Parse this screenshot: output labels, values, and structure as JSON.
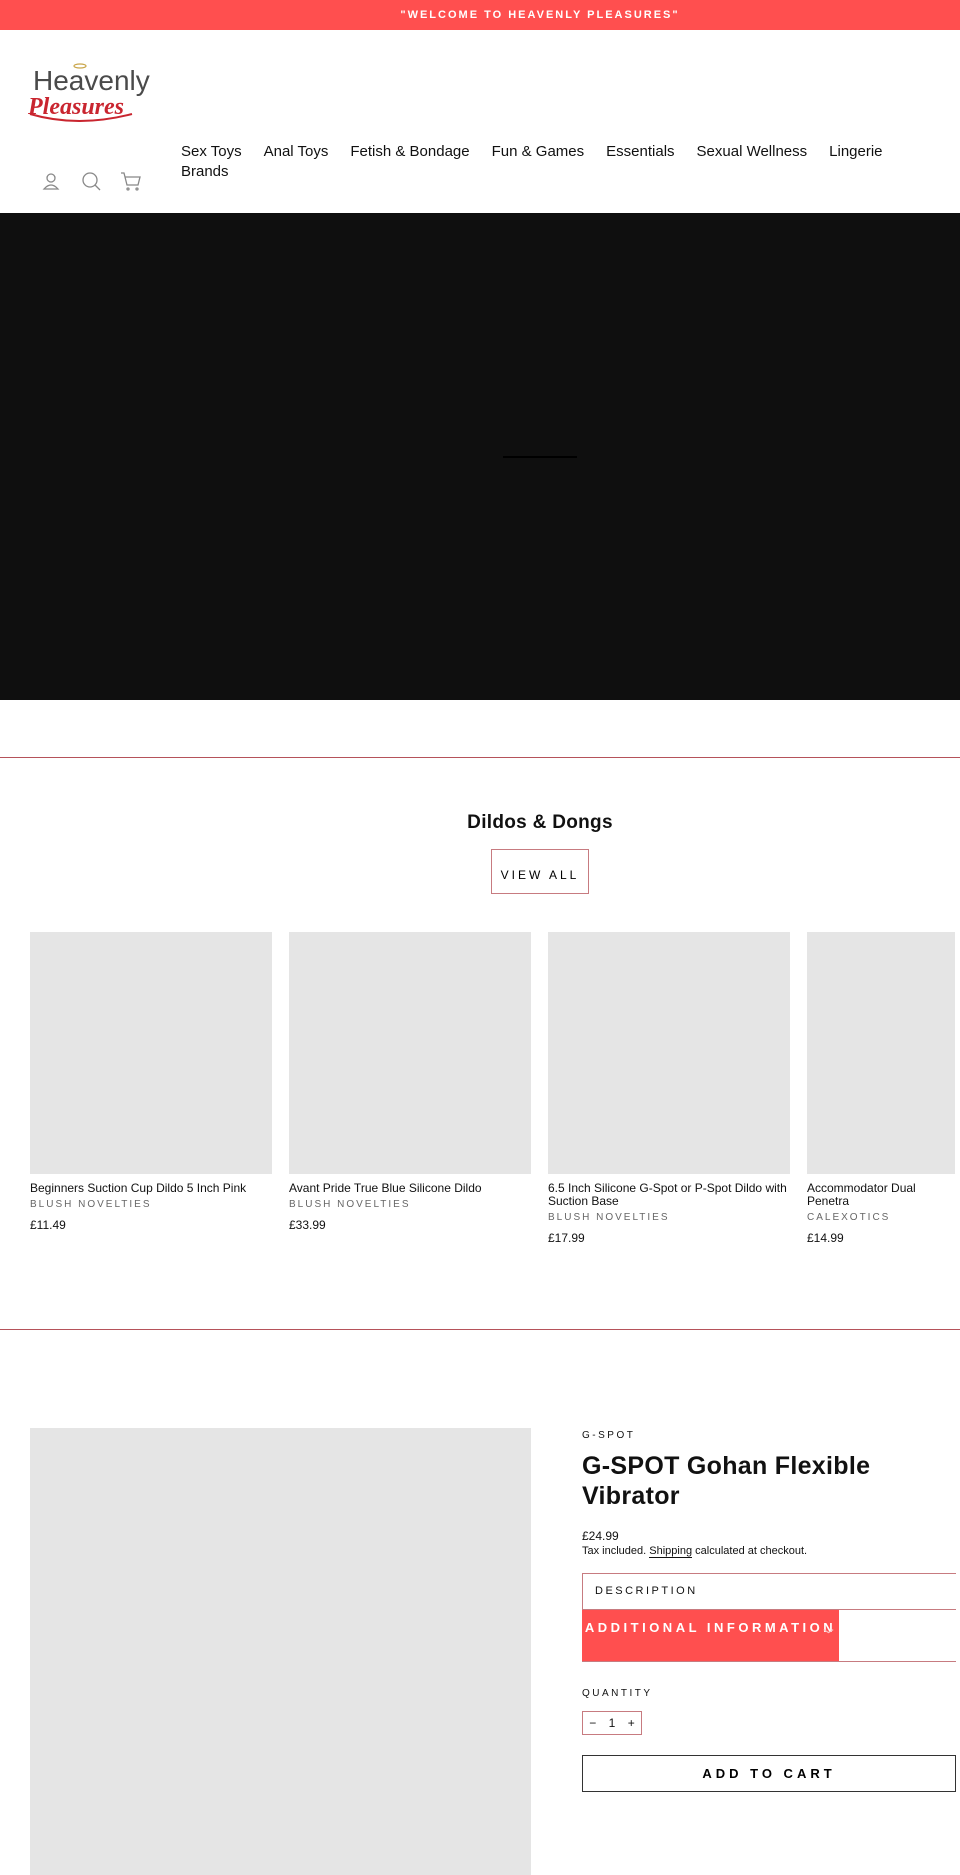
{
  "announcement": "\"WELCOME TO HEAVENLY PLEASURES\"",
  "logo": {
    "line1": "Heavenly",
    "line2": "Pleasures"
  },
  "nav": [
    "Sex Toys",
    "Anal Toys",
    "Fetish & Bondage",
    "Fun & Games",
    "Essentials",
    "Sexual Wellness",
    "Lingerie",
    "Brands"
  ],
  "icons": [
    "account-icon",
    "search-icon",
    "cart-icon"
  ],
  "collection": {
    "title": "Dildos & Dongs",
    "view_all": "VIEW ALL",
    "products": [
      {
        "name": "Beginners Suction Cup Dildo 5 Inch Pink",
        "vendor": "BLUSH NOVELTIES",
        "price": "£11.49"
      },
      {
        "name": "Avant Pride True Blue Silicone Dildo",
        "vendor": "BLUSH NOVELTIES",
        "price": "£33.99"
      },
      {
        "name": "6.5 Inch Silicone G-Spot or P-Spot Dildo with Suction Base",
        "vendor": "BLUSH NOVELTIES",
        "price": "£17.99"
      },
      {
        "name": "Accommodator Dual Penetra",
        "vendor": "CALEXOTICS",
        "price": "£14.99"
      }
    ]
  },
  "product": {
    "vendor": "G-SPOT",
    "title": "G-SPOT Gohan Flexible Vibrator",
    "price": "£24.99",
    "tax_pre": "Tax included.",
    "shipping": "Shipping",
    "tax_post": " calculated at checkout.",
    "description": "DESCRIPTION",
    "additional": "ADDITIONAL INFORMATION",
    "quantity_label": "QUANTITY",
    "quantity": "1",
    "minus": "−",
    "plus": "+",
    "add_to_cart": "ADD TO CART"
  },
  "colors": {
    "accent": "#ff4f4f",
    "border": "#c77b80",
    "hero": "#0f0f0f",
    "placeholder": "#e5e5e5"
  }
}
